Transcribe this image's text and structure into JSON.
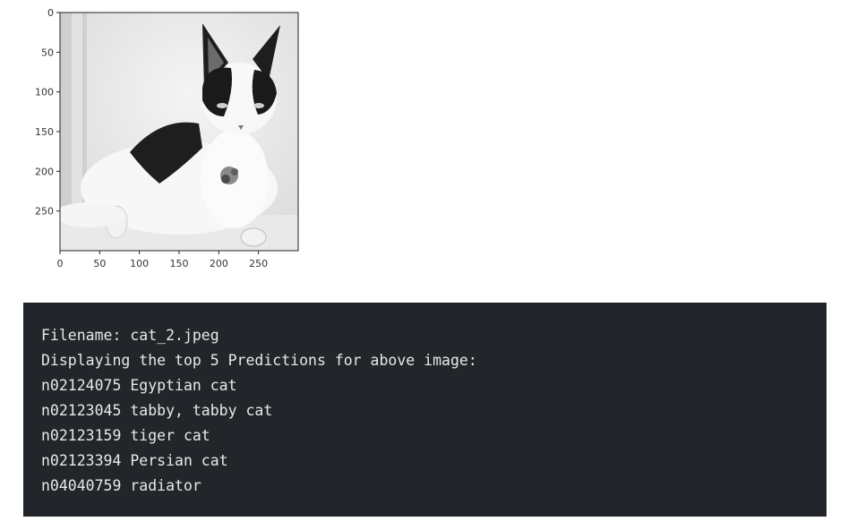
{
  "figure": {
    "image_subject": "black-and-white cat lying down, wearing a collar",
    "x_ticks": [
      "0",
      "50",
      "100",
      "150",
      "200",
      "250"
    ],
    "y_ticks": [
      "0",
      "50",
      "100",
      "150",
      "200",
      "250"
    ]
  },
  "output": {
    "lines": [
      "Filename: cat_2.jpeg",
      "Displaying the top 5 Predictions for above image:",
      "n02124075 Egyptian cat",
      "n02123045 tabby, tabby cat",
      "n02123159 tiger cat",
      "n02123394 Persian cat",
      "n04040759 radiator"
    ]
  },
  "colors": {
    "panel_background": "#222529",
    "panel_text": "#e8e8e8"
  }
}
